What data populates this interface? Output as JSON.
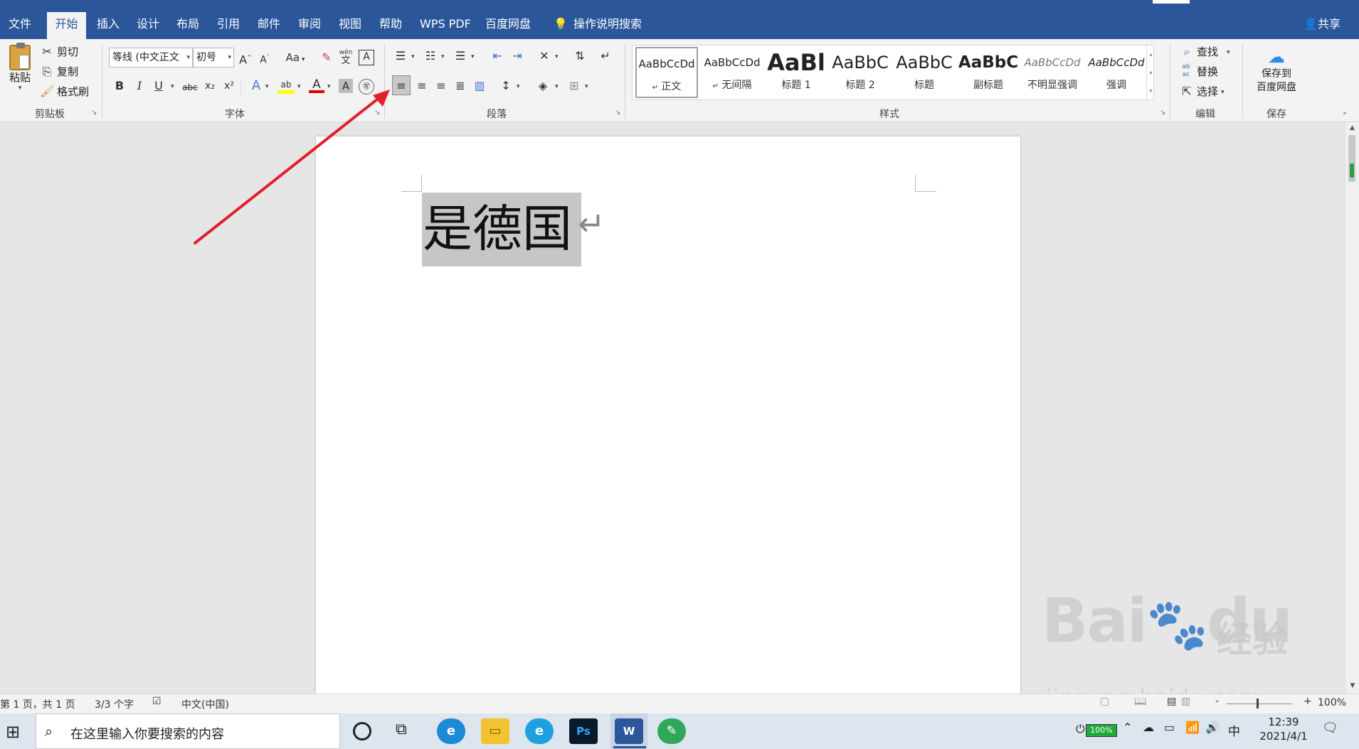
{
  "menu": {
    "tabs": [
      "文件",
      "开始",
      "插入",
      "设计",
      "布局",
      "引用",
      "邮件",
      "审阅",
      "视图",
      "帮助",
      "WPS PDF",
      "百度网盘"
    ],
    "search": "操作说明搜索",
    "share": "共享"
  },
  "clipboard": {
    "paste": "粘贴",
    "cut": "剪切",
    "copy": "复制",
    "format_painter": "格式刷",
    "group": "剪贴板"
  },
  "font": {
    "name": "等线 (中文正文",
    "size": "初号",
    "group": "字体",
    "change_case": "Aa",
    "bold": "B",
    "italic": "I",
    "underline": "U",
    "strike": "abc",
    "sub": "x₂",
    "sup": "x²",
    "font_color": "A",
    "char_shading": "A",
    "enclose": "㊢",
    "wen": "文",
    "char_border": "A",
    "grow": "A",
    "shrink": "A",
    "phonetic": "wén"
  },
  "paragraph": {
    "group": "段落"
  },
  "styles": {
    "group": "样式",
    "items": [
      {
        "preview": "AaBbCcDd",
        "name": "正文",
        "mark": "↵"
      },
      {
        "preview": "AaBbCcDd",
        "name": "无间隔",
        "mark": "↵"
      },
      {
        "preview": "AaBl",
        "name": "标题 1"
      },
      {
        "preview": "AaBbC",
        "name": "标题 2"
      },
      {
        "preview": "AaBbC",
        "name": "标题"
      },
      {
        "preview": "AaBbC",
        "name": "副标题"
      },
      {
        "preview": "AaBbCcDd",
        "name": "不明显强调"
      },
      {
        "preview": "AaBbCcDd",
        "name": "强调"
      }
    ]
  },
  "editing": {
    "find": "查找",
    "replace": "替换",
    "select": "选择",
    "group": "编辑",
    "ab": "ab",
    "ac": "ac"
  },
  "save": {
    "label1": "保存到",
    "label2": "百度网盘",
    "group": "保存"
  },
  "document": {
    "text": "是德国",
    "para_mark": "↵"
  },
  "status": {
    "page": "第 1 页，共 1 页",
    "words": "3/3 个字",
    "lang": "中文(中国)",
    "zoom": "100%",
    "zoom_minus": "-",
    "zoom_plus": "+"
  },
  "taskbar": {
    "search_placeholder": "在这里输入你要搜索的内容",
    "battery": "100%",
    "ime": "中",
    "time": "12:39",
    "date": "2021/4/1"
  },
  "watermark": {
    "brand": "Bai",
    "brand2": "du",
    "brand_cn": "经验",
    "url": "jingyan.baidu.com"
  },
  "colors": {
    "accent": "#2b579a",
    "arrow": "#e0202a",
    "highlight": "#ffff00",
    "font_red": "#e00000"
  }
}
